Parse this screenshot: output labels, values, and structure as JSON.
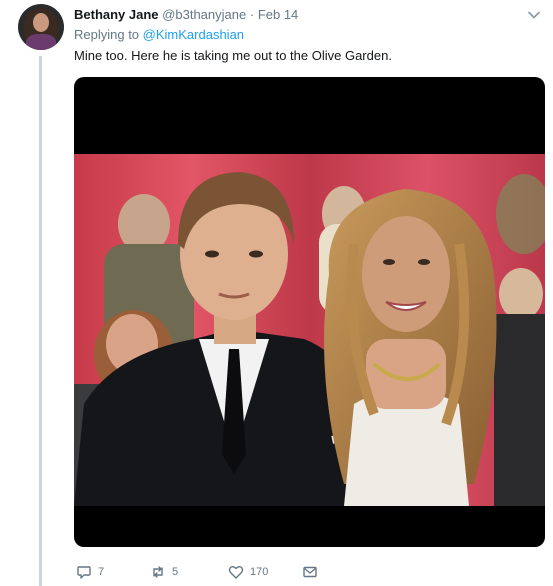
{
  "tweet": {
    "author_name": "Bethany Jane",
    "author_handle": "@b3thanyjane",
    "separator": "·",
    "date": "Feb 14",
    "replying_prefix": "Replying to",
    "replying_mention": "@KimKardashian",
    "text": "Mine too. Here he is taking me out to the Olive Garden."
  },
  "actions": {
    "reply_count": "7",
    "retweet_count": "5",
    "like_count": "170",
    "dm_count": ""
  },
  "icons": {
    "more": "chevron-down-icon",
    "reply": "comment-bubble-icon",
    "retweet": "retweet-arrows-icon",
    "like": "heart-icon",
    "dm": "envelope-icon"
  },
  "colors": {
    "link": "#1da1f2",
    "muted": "#657786",
    "text": "#14171a",
    "thread_line": "#ccd6dd"
  }
}
